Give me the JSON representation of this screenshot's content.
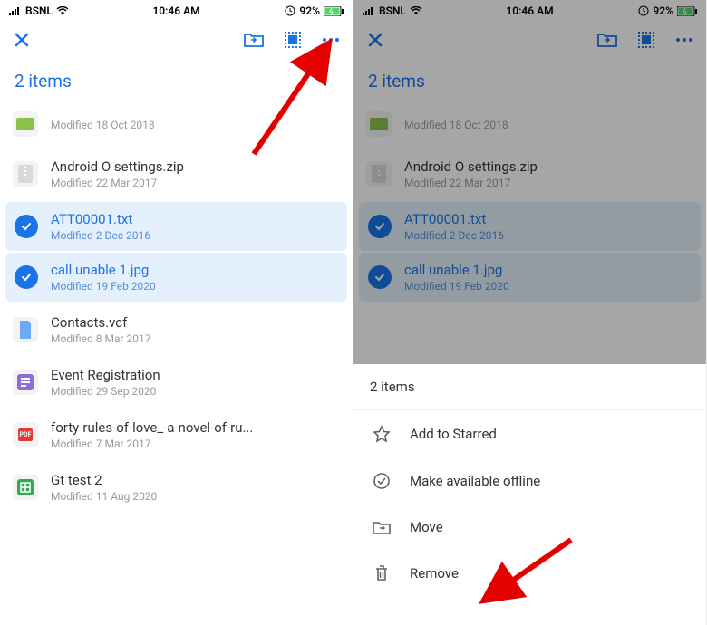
{
  "status": {
    "carrier": "BSNL",
    "time": "10:46 AM",
    "battery_pct": "92%"
  },
  "header": {
    "count_label": "2 items"
  },
  "files": [
    {
      "name": "",
      "sub": "Modified 18 Oct 2018",
      "icon": "image-green",
      "dimmed": true,
      "selected": false
    },
    {
      "name": "Android O settings.zip",
      "sub": "Modified 22 Mar 2017",
      "icon": "zip",
      "dimmed": false,
      "selected": false
    },
    {
      "name": "ATT00001.txt",
      "sub": "Modified 2 Dec 2016",
      "icon": "check",
      "dimmed": false,
      "selected": true
    },
    {
      "name": "call unable 1.jpg",
      "sub": "Modified 19 Feb 2020",
      "icon": "check",
      "dimmed": false,
      "selected": true
    },
    {
      "name": "Contacts.vcf",
      "sub": "Modified 8 Mar 2017",
      "icon": "doc-blue",
      "dimmed": false,
      "selected": false
    },
    {
      "name": "Event Registration",
      "sub": "Modified 29 Sep 2020",
      "icon": "form-purple",
      "dimmed": false,
      "selected": false
    },
    {
      "name": "forty-rules-of-love_-a-novel-of-ru...",
      "sub": "Modified 7 Mar 2017",
      "icon": "pdf",
      "dimmed": false,
      "selected": false
    },
    {
      "name": "Gt test 2",
      "sub": "Modified 11 Aug 2020",
      "icon": "sheet-green",
      "dimmed": false,
      "selected": false
    }
  ],
  "sheet": {
    "title": "2 items",
    "actions": [
      {
        "label": "Add to Starred",
        "icon": "star"
      },
      {
        "label": "Make available offline",
        "icon": "offline"
      },
      {
        "label": "Move",
        "icon": "move"
      },
      {
        "label": "Remove",
        "icon": "trash"
      }
    ]
  },
  "colors": {
    "accent": "#1a73e8"
  }
}
